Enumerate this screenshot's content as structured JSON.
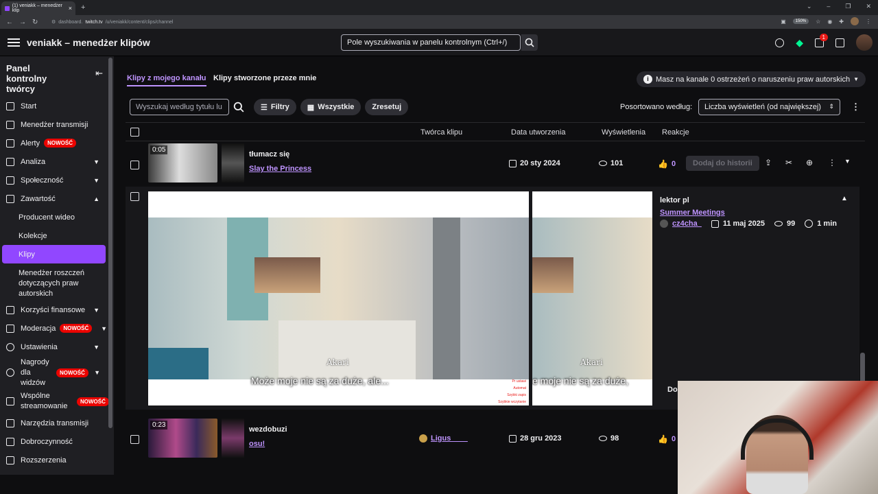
{
  "browser": {
    "tab_title": "(1) veniakk – menedżer klip",
    "url_prefix": "dashboard.",
    "url_domain": "twitch.tv",
    "url_path": "/u/veniakk/content/clips/channel",
    "zoom": "150%",
    "new_tab": "+"
  },
  "topbar": {
    "title": "veniakk – menedżer klipów",
    "search_placeholder": "Pole wyszukiwania w panelu kontrolnym (Ctrl+/)",
    "notification_count": "1"
  },
  "sidebar": {
    "heading": "Panel kontrolny twórcy",
    "new_badge": "NOWOŚĆ",
    "items": [
      {
        "label": "Start"
      },
      {
        "label": "Menedżer transmisji"
      },
      {
        "label": "Alerty"
      },
      {
        "label": "Analiza"
      },
      {
        "label": "Społeczność"
      },
      {
        "label": "Zawartość"
      },
      {
        "label": "Producent wideo"
      },
      {
        "label": "Kolekcje"
      },
      {
        "label": "Klipy"
      },
      {
        "label": "Menedżer roszczeń dotyczących praw autorskich"
      },
      {
        "label": "Korzyści finansowe"
      },
      {
        "label": "Moderacja"
      },
      {
        "label": "Ustawienia"
      },
      {
        "label": "Nagrody dla widzów"
      },
      {
        "label": "Wspólne streamowanie"
      },
      {
        "label": "Narzędzia transmisji"
      },
      {
        "label": "Dobroczynność"
      },
      {
        "label": "Rozszerzenia"
      }
    ]
  },
  "tabs": {
    "mine": "Klipy z mojego kanału",
    "created_by_me": "Klipy stworzone przeze mnie"
  },
  "copyright_notice": "Masz na kanale 0 ostrzeżeń o naruszeniu praw autorskich",
  "filters": {
    "search_placeholder": "Wyszukaj według tytułu lu",
    "filters_label": "Filtry",
    "date_label": "Wszystkie",
    "reset_label": "Zresetuj",
    "sort_label": "Posortowano według:",
    "sort_value": "Liczba wyświetleń (od największej)"
  },
  "table": {
    "headers": {
      "creator": "Twórca klipu",
      "date": "Data utworzenia",
      "views": "Wyświetlenia",
      "reactions": "Reakcje"
    },
    "rows": [
      {
        "duration": "0:05",
        "title": "tłumacz się",
        "game": "Slay the Princess",
        "creator": "",
        "date": "20 sty 2024",
        "views": "101",
        "likes": "0",
        "add_to_story": "Dodaj do historii"
      },
      {
        "duration": "0:23",
        "title": "wezdobuzi",
        "game": "osu!",
        "creator": "Ligus____",
        "date": "28 gru 2023",
        "views": "98",
        "likes": "0"
      }
    ]
  },
  "expanded_clip": {
    "speaker": "Akari",
    "subtitle": "Może moje nie są za duże, ale...",
    "subtitle_cut": "e moje nie są za duże,",
    "player_menu": [
      "Pr ustawi",
      "Automat",
      "Szybki zapis",
      "Szybkie wczytanie"
    ],
    "side_title": "lektor pl",
    "side_game": "Summer Meetings",
    "side_creator": "cz4cha_",
    "side_date": "11 maj 2025",
    "side_views": "99",
    "side_duration": "1 min",
    "side_button_cut": "Do"
  },
  "colors": {
    "accent": "#9147ff",
    "link": "#bf94ff",
    "new_badge": "#eb0400"
  }
}
